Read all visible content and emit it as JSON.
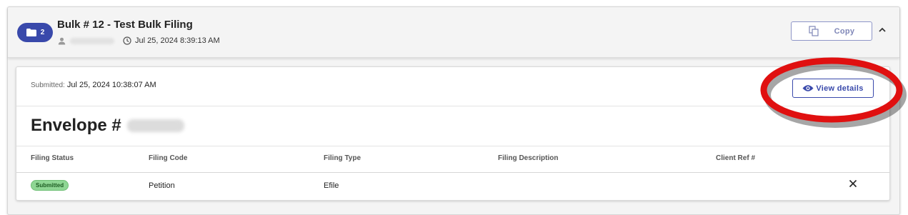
{
  "bulk": {
    "folder_count": "2",
    "title": "Bulk # 12 - Test Bulk Filing",
    "created": "Jul 25, 2024 8:39:13 AM",
    "copy_label": "Copy"
  },
  "envelope": {
    "submitted_label": "Submitted:",
    "submitted_value": "Jul 25, 2024 10:38:07 AM",
    "view_details_label": "View details",
    "title": "Envelope #"
  },
  "table": {
    "headers": [
      "Filing Status",
      "Filing Code",
      "Filing Type",
      "Filing Description",
      "Client Ref #"
    ],
    "rows": [
      {
        "status": "Submitted",
        "code": "Petition",
        "type": "Efile",
        "description": "",
        "client_ref": ""
      }
    ]
  },
  "colors": {
    "primary": "#3949ab",
    "status_badge": "#8fd694",
    "annotation": "#e01010"
  },
  "icons": [
    "folder-icon",
    "user-icon",
    "clock-icon",
    "copy-icon",
    "chevron-up-icon",
    "eye-icon",
    "close-icon"
  ]
}
